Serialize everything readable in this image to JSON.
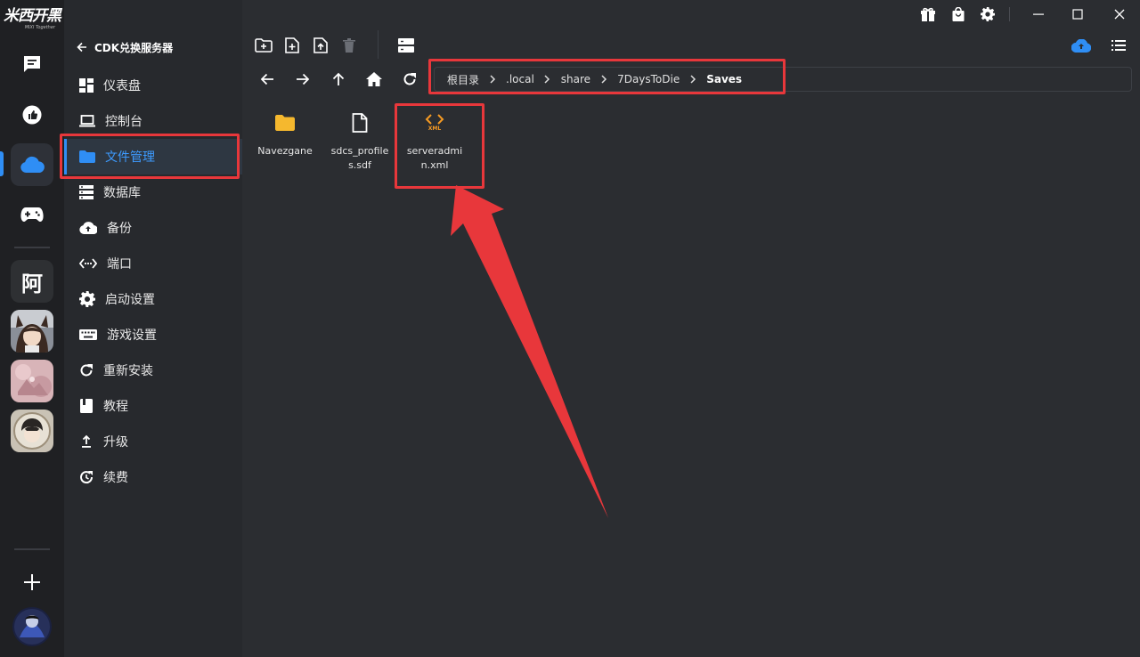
{
  "app": {
    "logo_text": "米西开黑",
    "logo_subtext": "MIXI Together"
  },
  "rail": {
    "text_avatar": "阿",
    "icons": [
      "chat-icon",
      "like-icon",
      "cloud-icon",
      "gamepad-icon",
      "add-icon"
    ]
  },
  "sidebar": {
    "back_label": "CDK兑换服务器",
    "items": [
      {
        "label": "仪表盘",
        "icon": "dashboard-icon"
      },
      {
        "label": "控制台",
        "icon": "laptop-icon"
      },
      {
        "label": "文件管理",
        "icon": "folder-icon",
        "active": true
      },
      {
        "label": "数据库",
        "icon": "database-icon"
      },
      {
        "label": "备份",
        "icon": "cloud-upload-icon"
      },
      {
        "label": "端口",
        "icon": "port-icon"
      },
      {
        "label": "启动设置",
        "icon": "gear-icon"
      },
      {
        "label": "游戏设置",
        "icon": "keyboard-icon"
      },
      {
        "label": "重新安装",
        "icon": "refresh-icon"
      },
      {
        "label": "教程",
        "icon": "book-icon"
      },
      {
        "label": "升级",
        "icon": "upgrade-icon"
      },
      {
        "label": "续费",
        "icon": "renew-icon"
      }
    ]
  },
  "breadcrumb": [
    "根目录",
    ".local",
    "share",
    "7DaysToDie",
    "Saves"
  ],
  "files": [
    {
      "name": "Navezgane",
      "type": "folder"
    },
    {
      "name": "sdcs_profiles.sdf",
      "type": "file"
    },
    {
      "name": "serveradmin.xml",
      "type": "xml",
      "badge": "XML"
    }
  ],
  "colors": {
    "accent": "#2f8ef5",
    "folder": "#f5b82e",
    "xml": "#f59a23",
    "annotation": "#e8373b"
  }
}
